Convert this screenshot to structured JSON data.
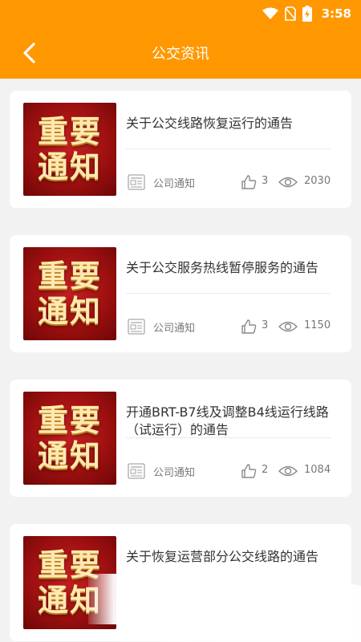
{
  "status_bar": {
    "time": "3:58"
  },
  "header": {
    "title": "公交资讯",
    "back_icon": "chevron-left-icon"
  },
  "colors": {
    "header": "#ff9800",
    "thumb": "#b31515",
    "text": "#333333",
    "meta": "#777777"
  },
  "notices": [
    {
      "thumb_line1": "重要",
      "thumb_line2": "通知",
      "title": "关于公交线路恢复运行的通告",
      "category": "公司通知",
      "likes": "3",
      "views": "2030"
    },
    {
      "thumb_line1": "重要",
      "thumb_line2": "通知",
      "title": "关于公交服务热线暂停服务的通告",
      "category": "公司通知",
      "likes": "3",
      "views": "1150"
    },
    {
      "thumb_line1": "重要",
      "thumb_line2": "通知",
      "title": "开通BRT-B7线及调整B4线运行线路（试运行）的通告",
      "category": "公司通知",
      "likes": "2",
      "views": "1084"
    },
    {
      "thumb_line1": "重要",
      "thumb_line2": "通知",
      "title": "关于恢复运营部分公交线路的通告",
      "category": "",
      "likes": "",
      "views": ""
    }
  ]
}
